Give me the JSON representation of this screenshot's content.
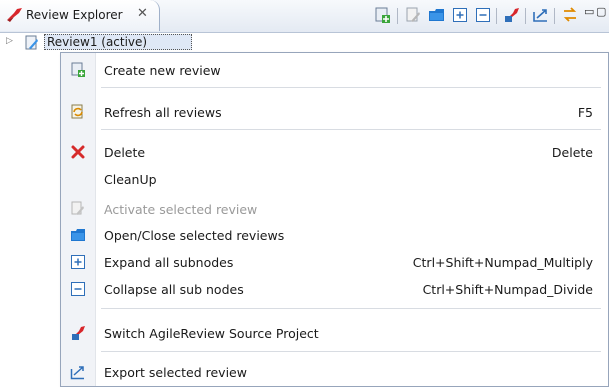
{
  "view": {
    "tab_title": "Review Explorer",
    "close_glyph": "✕",
    "min_glyph": "▭",
    "max_glyph": "▢"
  },
  "toolbar_icons": [
    "new-review-icon",
    "activate-icon",
    "folder-icon",
    "expand-all-icon",
    "collapse-all-icon",
    "switch-project-icon",
    "export-icon",
    "link-with-editor-icon"
  ],
  "tree": {
    "item_label": "Review1 (active)"
  },
  "menu": {
    "items": [
      {
        "label": "Create new review",
        "shortcut": "",
        "icon": "new-review-icon",
        "enabled": true
      },
      {
        "label": "Refresh all reviews",
        "shortcut": "F5",
        "icon": "refresh-icon",
        "enabled": true
      },
      {
        "label": "Delete",
        "shortcut": "Delete",
        "icon": "delete-icon",
        "enabled": true
      },
      {
        "label": "CleanUp",
        "shortcut": "",
        "icon": "",
        "enabled": true
      },
      {
        "label": "Activate selected review",
        "shortcut": "",
        "icon": "activate-icon",
        "enabled": false
      },
      {
        "label": "Open/Close selected reviews",
        "shortcut": "",
        "icon": "folder-icon",
        "enabled": true
      },
      {
        "label": "Expand all subnodes",
        "shortcut": "Ctrl+Shift+Numpad_Multiply",
        "icon": "expand-all-icon",
        "enabled": true
      },
      {
        "label": "Collapse all sub nodes",
        "shortcut": "Ctrl+Shift+Numpad_Divide",
        "icon": "collapse-all-icon",
        "enabled": true
      },
      {
        "label": "Switch AgileReview Source Project",
        "shortcut": "",
        "icon": "switch-project-icon",
        "enabled": true
      },
      {
        "label": "Export selected review",
        "shortcut": "",
        "icon": "export-icon",
        "enabled": true
      }
    ]
  },
  "colors": {
    "accent": "#3b78d8",
    "delete_red": "#d62b2b",
    "header_bg": "#e4eaf3"
  }
}
